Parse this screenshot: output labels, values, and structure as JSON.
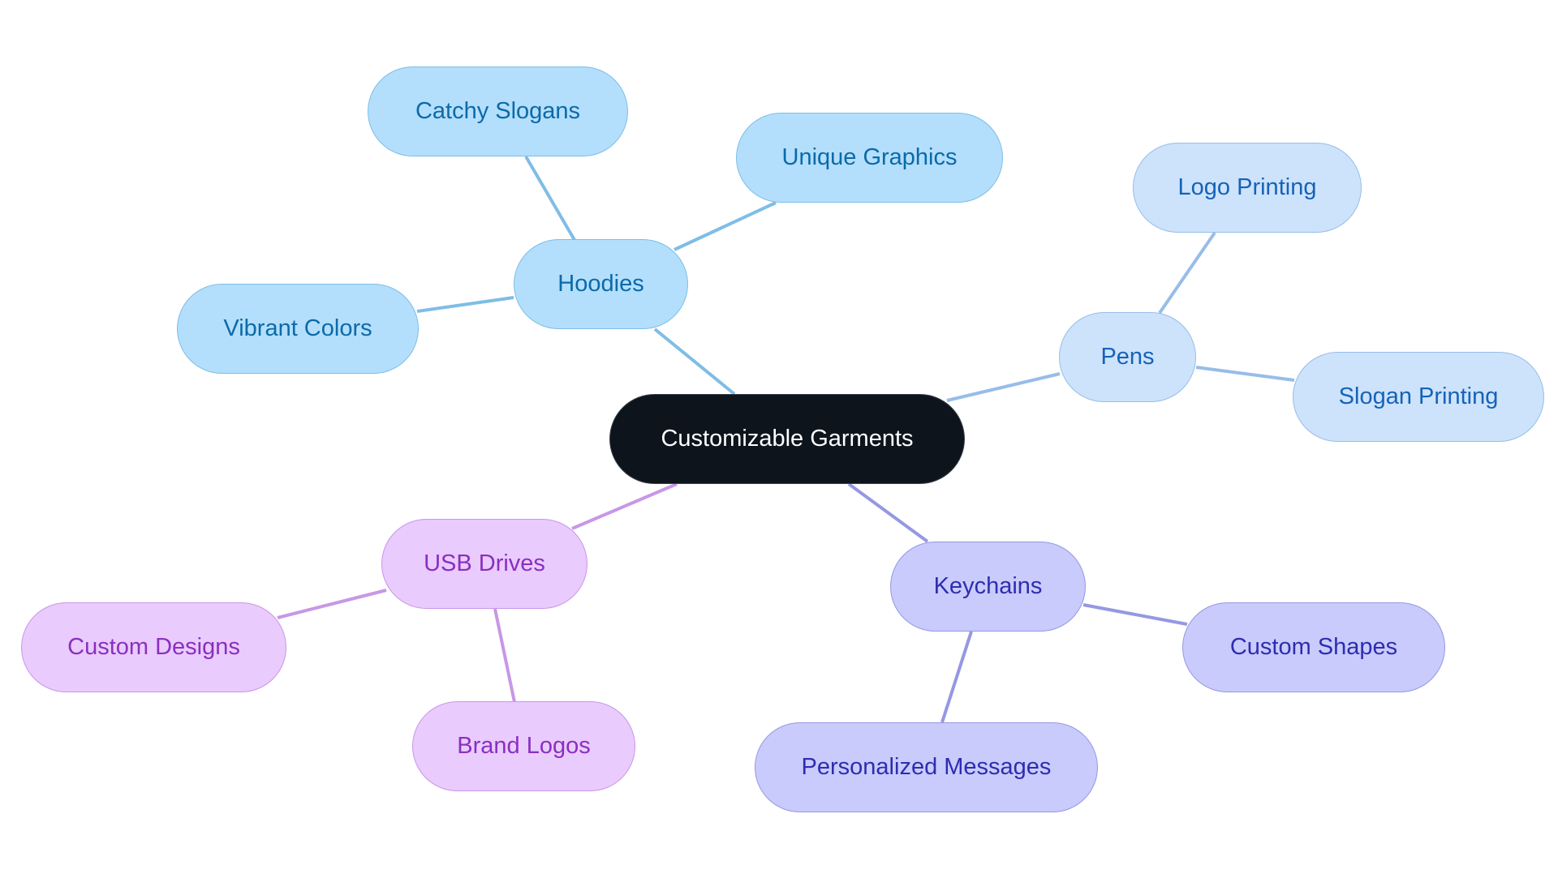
{
  "diagram": {
    "type": "mindmap",
    "root": {
      "id": "root",
      "label": "Customizable Garments"
    },
    "branches": [
      {
        "id": "hoodies",
        "label": "Hoodies",
        "theme": "blue",
        "children": [
          {
            "id": "catchy-slogans",
            "label": "Catchy Slogans"
          },
          {
            "id": "unique-graphics",
            "label": "Unique Graphics"
          },
          {
            "id": "vibrant-colors",
            "label": "Vibrant Colors"
          }
        ]
      },
      {
        "id": "pens",
        "label": "Pens",
        "theme": "lblue",
        "children": [
          {
            "id": "logo-printing",
            "label": "Logo Printing"
          },
          {
            "id": "slogan-printing",
            "label": "Slogan Printing"
          }
        ]
      },
      {
        "id": "usb-drives",
        "label": "USB Drives",
        "theme": "purple",
        "children": [
          {
            "id": "custom-designs",
            "label": "Custom Designs"
          },
          {
            "id": "brand-logos",
            "label": "Brand Logos"
          }
        ]
      },
      {
        "id": "keychains",
        "label": "Keychains",
        "theme": "indigo",
        "children": [
          {
            "id": "custom-shapes",
            "label": "Custom Shapes"
          },
          {
            "id": "personalized-messages",
            "label": "Personalized Messages"
          }
        ]
      }
    ],
    "colors": {
      "root_fill": "#0d141c",
      "blue_fill": "#b3dffc",
      "blue_edge": "#7fbde6",
      "blue_text": "#0c6aa8",
      "lblue_fill": "#cde3fb",
      "lblue_edge": "#97bde8",
      "lblue_text": "#1662b8",
      "indigo_fill": "#c9cbfc",
      "indigo_edge": "#9598e2",
      "indigo_text": "#2d2db0",
      "purple_fill": "#e9cbfd",
      "purple_edge": "#c897e6",
      "purple_text": "#8a2fc0"
    }
  }
}
